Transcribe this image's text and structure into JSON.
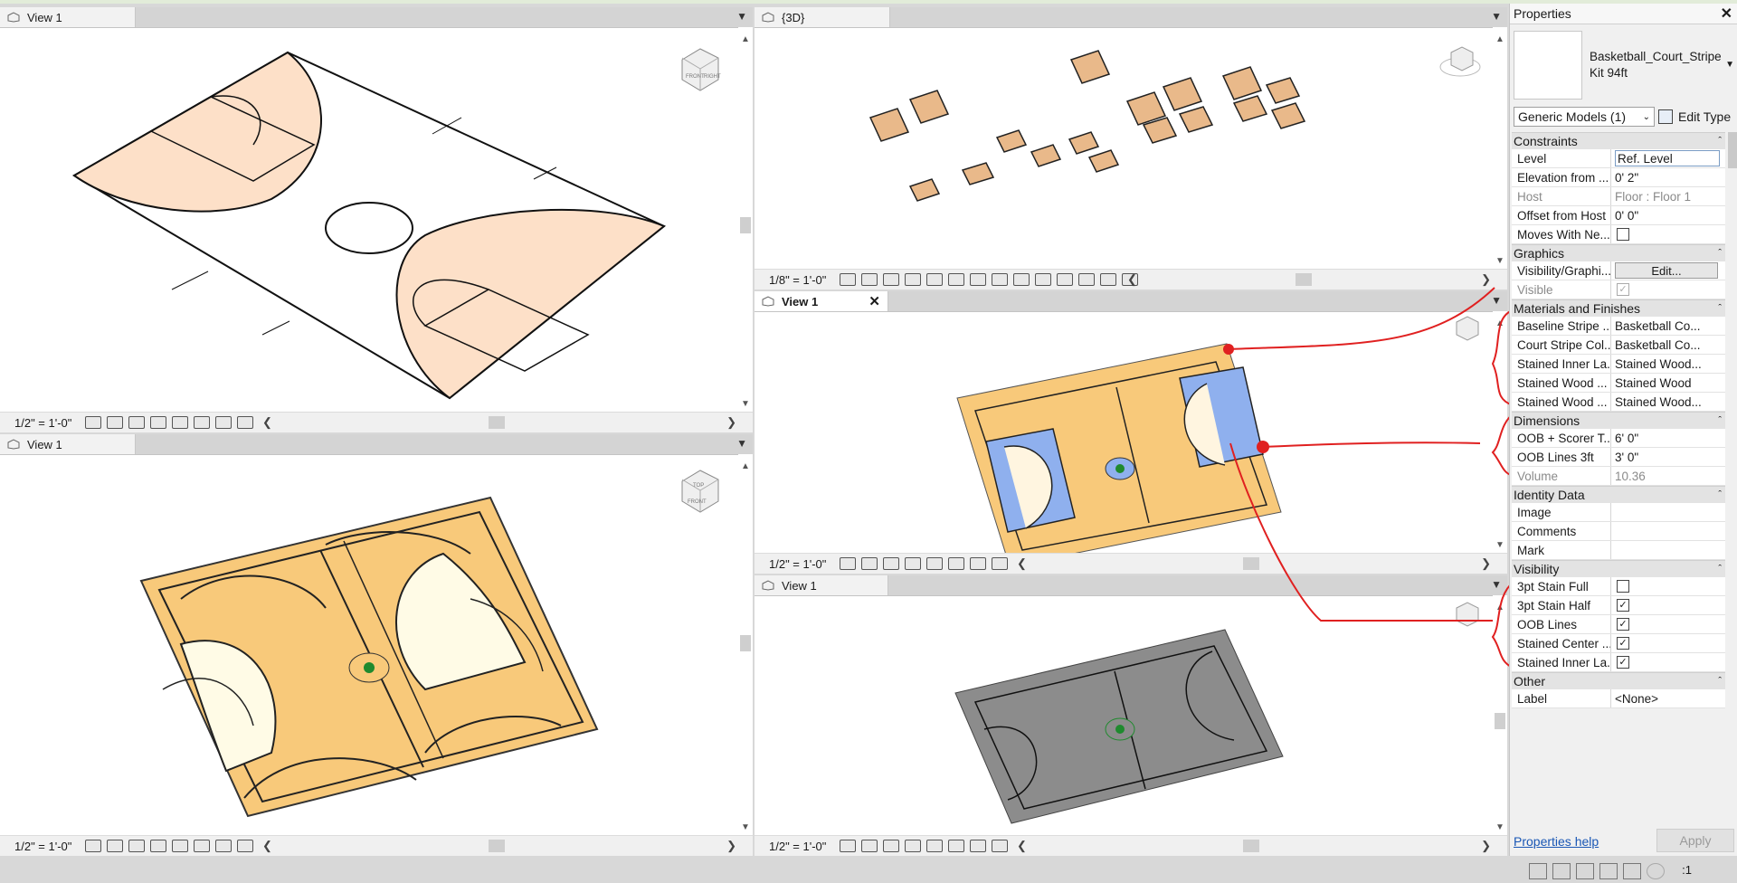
{
  "views": {
    "top_left": {
      "tab": "View 1",
      "scale": "1/2\" = 1'-0\""
    },
    "bottom_left": {
      "tab": "View 1",
      "scale": "1/2\" = 1'-0\""
    },
    "top_right": {
      "tab": "{3D}",
      "scale": "1/8\" = 1'-0\""
    },
    "mid_right": {
      "tab": "View 1",
      "scale": "1/2\" = 1'-0\"",
      "close": "✕"
    },
    "bottom_right": {
      "tab": "View 1",
      "scale": "1/2\" = 1'-0\""
    }
  },
  "cube_labels": {
    "top_left": [
      "FRONT",
      "RIGHT"
    ],
    "bottom_left": [
      "TOP",
      "FRONT"
    ]
  },
  "properties": {
    "title": "Properties",
    "close": "✕",
    "type_name": "Basketball_Court_Stripe Kit 94ft",
    "filter": "Generic Models (1)",
    "edit_type": "Edit Type",
    "help": "Properties help",
    "apply": "Apply",
    "sections": [
      {
        "name": "Constraints",
        "rows": [
          {
            "key": "Level",
            "value": "Ref. Level",
            "kind": "input"
          },
          {
            "key": "Elevation from ...",
            "value": "0'  2\"",
            "kind": "text"
          },
          {
            "key": "Host",
            "value": "Floor : Floor 1",
            "kind": "readonly"
          },
          {
            "key": "Offset from Host",
            "value": "0'  0\"",
            "kind": "text"
          },
          {
            "key": "Moves With Ne...",
            "value": "",
            "kind": "check",
            "checked": false
          }
        ]
      },
      {
        "name": "Graphics",
        "rows": [
          {
            "key": "Visibility/Graphi...",
            "value": "Edit...",
            "kind": "button"
          },
          {
            "key": "Visible",
            "value": "",
            "kind": "check-disabled",
            "checked": true
          }
        ]
      },
      {
        "name": "Materials and Finishes",
        "rows": [
          {
            "key": "Baseline Stripe ...",
            "value": "Basketball Co...",
            "kind": "text"
          },
          {
            "key": "Court Stripe Col...",
            "value": "Basketball Co...",
            "kind": "text"
          },
          {
            "key": "Stained Inner La...",
            "value": "Stained Wood...",
            "kind": "text"
          },
          {
            "key": "Stained Wood ...",
            "value": "Stained Wood",
            "kind": "text"
          },
          {
            "key": "Stained Wood ...",
            "value": "Stained Wood...",
            "kind": "text"
          }
        ]
      },
      {
        "name": "Dimensions",
        "rows": [
          {
            "key": "OOB + Scorer T...",
            "value": "6'  0\"",
            "kind": "text"
          },
          {
            "key": "OOB Lines 3ft",
            "value": "3'  0\"",
            "kind": "text"
          },
          {
            "key": "Volume",
            "value": "10.36",
            "kind": "readonly"
          }
        ]
      },
      {
        "name": "Identity Data",
        "rows": [
          {
            "key": "Image",
            "value": "",
            "kind": "text"
          },
          {
            "key": "Comments",
            "value": "",
            "kind": "text"
          },
          {
            "key": "Mark",
            "value": "",
            "kind": "text"
          }
        ]
      },
      {
        "name": "Visibility",
        "rows": [
          {
            "key": "3pt Stain Full",
            "value": "",
            "kind": "check",
            "checked": false
          },
          {
            "key": "3pt Stain Half",
            "value": "",
            "kind": "check",
            "checked": true
          },
          {
            "key": "OOB Lines",
            "value": "",
            "kind": "check",
            "checked": true
          },
          {
            "key": "Stained Center ...",
            "value": "",
            "kind": "check",
            "checked": true
          },
          {
            "key": "Stained Inner La...",
            "value": "",
            "kind": "check",
            "checked": true
          }
        ]
      },
      {
        "name": "Other",
        "rows": [
          {
            "key": "Label",
            "value": "<None>",
            "kind": "text"
          }
        ]
      }
    ]
  },
  "status": {
    "filter_count": ":1"
  },
  "colors": {
    "court_peach": "#fde0c8",
    "wood": "#f8c97a",
    "blue": "#8fb0ee",
    "gray": "#8c8c8c",
    "annotation": "#e02020",
    "center_dot": "#1f8a2e"
  }
}
